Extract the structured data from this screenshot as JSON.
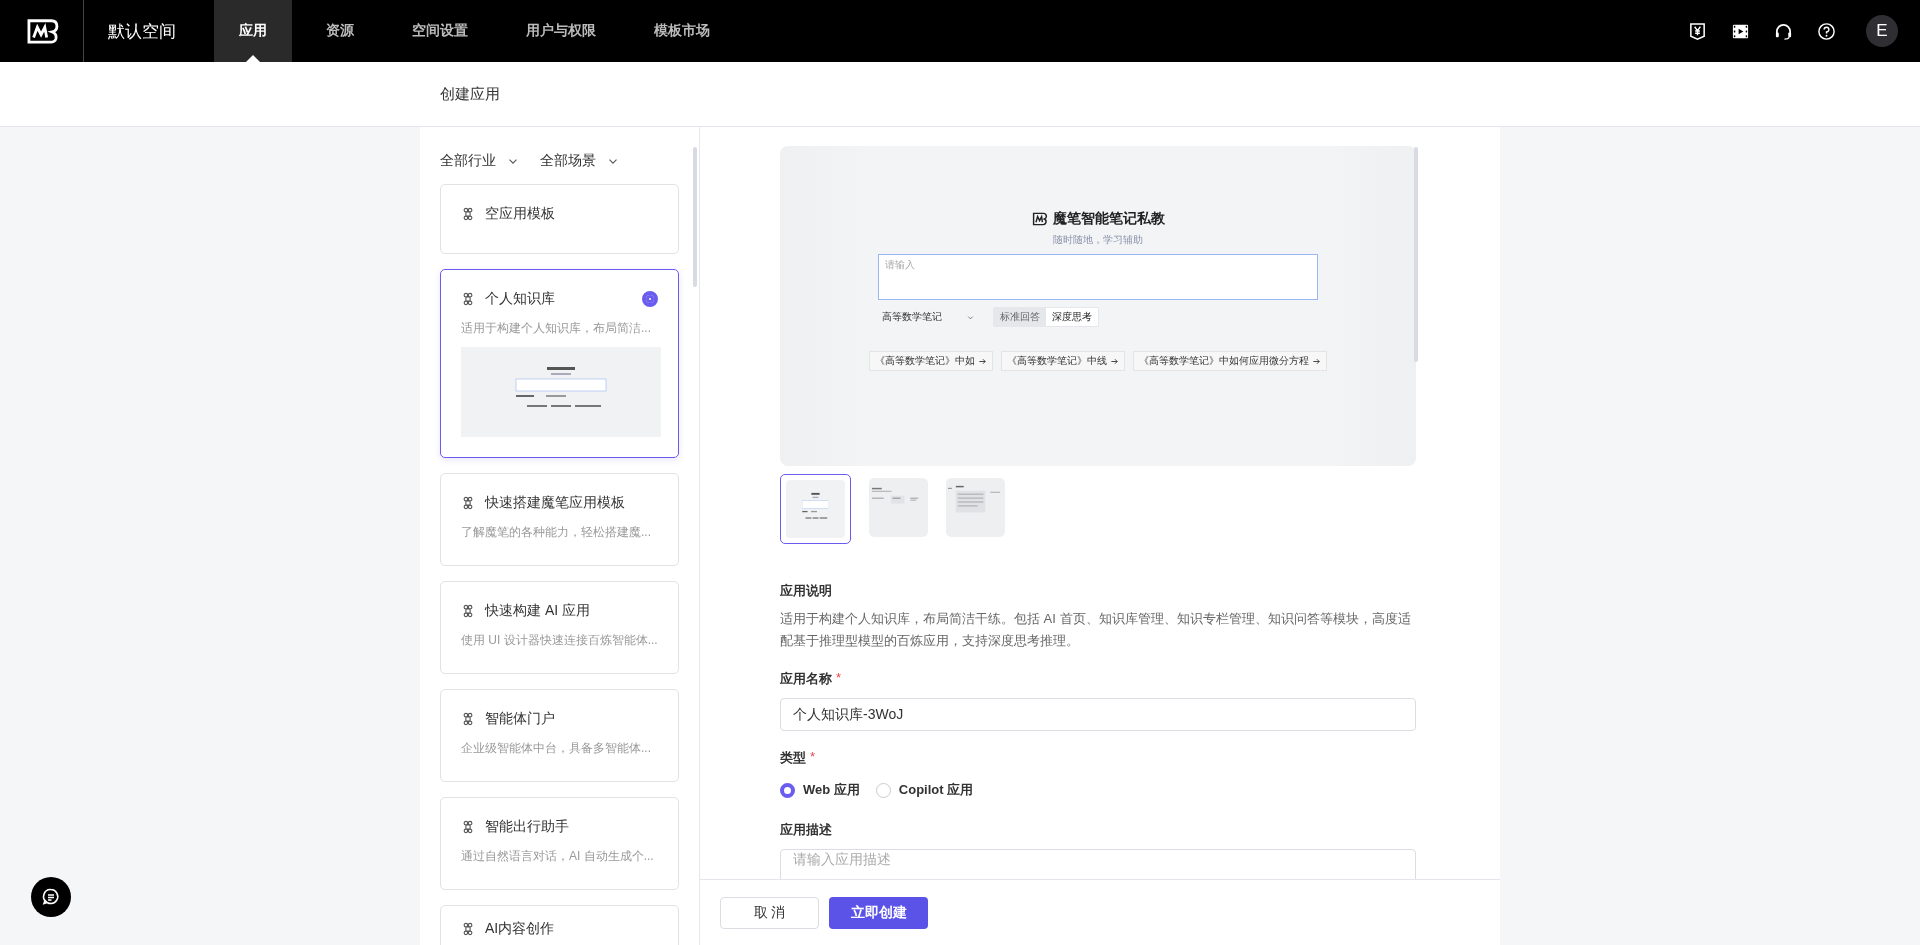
{
  "topbar": {
    "workspace": "默认空间",
    "tabs": [
      {
        "label": "应用",
        "selected": true
      },
      {
        "label": "资源",
        "selected": false
      },
      {
        "label": "空间设置",
        "selected": false
      },
      {
        "label": "用户与权限",
        "selected": false
      },
      {
        "label": "模板市场",
        "selected": false
      }
    ],
    "avatar": "E"
  },
  "page_title": "创建应用",
  "filters": [
    {
      "label": "全部行业"
    },
    {
      "label": "全部场景"
    }
  ],
  "templates": [
    {
      "title": "空应用模板",
      "selected": false
    },
    {
      "title": "个人知识库",
      "description": "适用于构建个人知识库，布局简洁...",
      "selected": true
    },
    {
      "title": "快速搭建魔笔应用模板",
      "description": "了解魔笔的各种能力，轻松搭建魔...",
      "selected": false
    },
    {
      "title": "快速构建 AI 应用",
      "description": "使用 UI 设计器快速连接百炼智能体...",
      "selected": false
    },
    {
      "title": "智能体门户",
      "description": "企业级智能体中台，具备多智能体...",
      "selected": false
    },
    {
      "title": "智能出行助手",
      "description": "通过自然语言对话，AI 自动生成个...",
      "selected": false
    },
    {
      "title": "AI内容创作",
      "selected": false
    }
  ],
  "preview": {
    "title": "魔笔智能笔记私教",
    "subtitle": "随时随地，学习辅助",
    "placeholder": "请输入",
    "notebook": "高等数学笔记",
    "modes": [
      {
        "label": "标准回答",
        "selected": false
      },
      {
        "label": "深度思考",
        "selected": true
      }
    ],
    "suggestions": [
      "《高等数学笔记》中如",
      "《高等数学笔记》中线",
      "《高等数学笔记》中如何应用微分方程"
    ]
  },
  "thumbnails": [
    {
      "kind": "home",
      "selected": true
    },
    {
      "kind": "list",
      "selected": false
    },
    {
      "kind": "document",
      "selected": false
    }
  ],
  "form": {
    "description_label": "应用说明",
    "description_text": "适用于构建个人知识库，布局简洁干练。包括 AI 首页、知识库管理、知识专栏管理、知识问答等模块，高度适配基于推理型模型的百炼应用，支持深度思考推理。",
    "name_label": "应用名称",
    "name_required": "*",
    "name_value": "个人知识库-3WoJ",
    "type_label": "类型",
    "type_required": "*",
    "types": [
      {
        "label": "Web 应用",
        "selected": true
      },
      {
        "label": "Copilot 应用",
        "selected": false
      }
    ],
    "app_desc_label": "应用描述",
    "app_desc_placeholder": "请输入应用描述"
  },
  "actions": {
    "cancel": "取 消",
    "create": "立即创建"
  }
}
